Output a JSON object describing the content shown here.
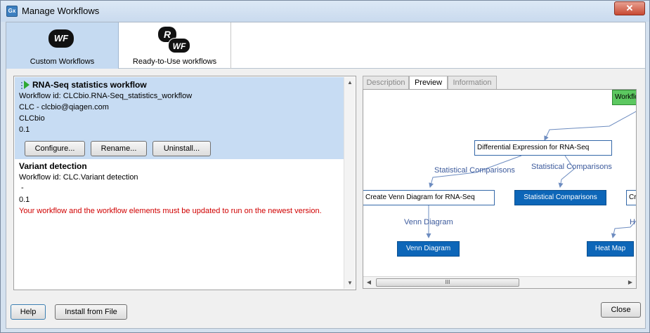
{
  "window": {
    "title": "Manage Workflows",
    "app_icon": "Gx",
    "close_glyph": "✕"
  },
  "toolbar": {
    "custom_label": "Custom Workflows",
    "custom_icon_text": "WF",
    "ready_label": "Ready-to-Use workflows",
    "ready_icon_r": "R",
    "ready_icon_wf": "WF"
  },
  "workflows": [
    {
      "title": "RNA-Seq statistics workflow",
      "id_line": "Workflow id: CLCbio.RNA-Seq_statistics_workflow",
      "author": "CLC - clcbio@qiagen.com",
      "org": "CLCbio",
      "version": "0.1",
      "buttons": {
        "configure": "Configure...",
        "rename": "Rename...",
        "uninstall": "Uninstall..."
      }
    },
    {
      "title": "Variant detection",
      "id_line": "Workflow id: CLC.Variant detection",
      "author": " -",
      "version": "0.1",
      "warning": "Your workflow and the workflow elements must be updated to run on the newest version."
    }
  ],
  "tabs": {
    "description": "Description",
    "preview": "Preview",
    "information": "Information"
  },
  "preview": {
    "nodes": {
      "top": "Workflow",
      "diff": "Differential Expression for RNA-Seq",
      "venn_create": "Create Venn Diagram for RNA-Seq",
      "stat": "Statistical Comparisons",
      "cut": "Cr",
      "venn": "Venn Diagram",
      "heat": "Heat Map"
    },
    "edges": {
      "stat1": "Statistical Comparisons",
      "stat2": "Statistical Comparisons",
      "venn": "Venn Diagram",
      "h": "H"
    },
    "scroll_grip": "III"
  },
  "buttons": {
    "help": "Help",
    "install": "Install from File",
    "close": "Close"
  },
  "colors": {
    "accent": "#0d66b8",
    "selected": "#c7dcf3",
    "warning": "#d00000",
    "node_green": "#5cc860"
  }
}
